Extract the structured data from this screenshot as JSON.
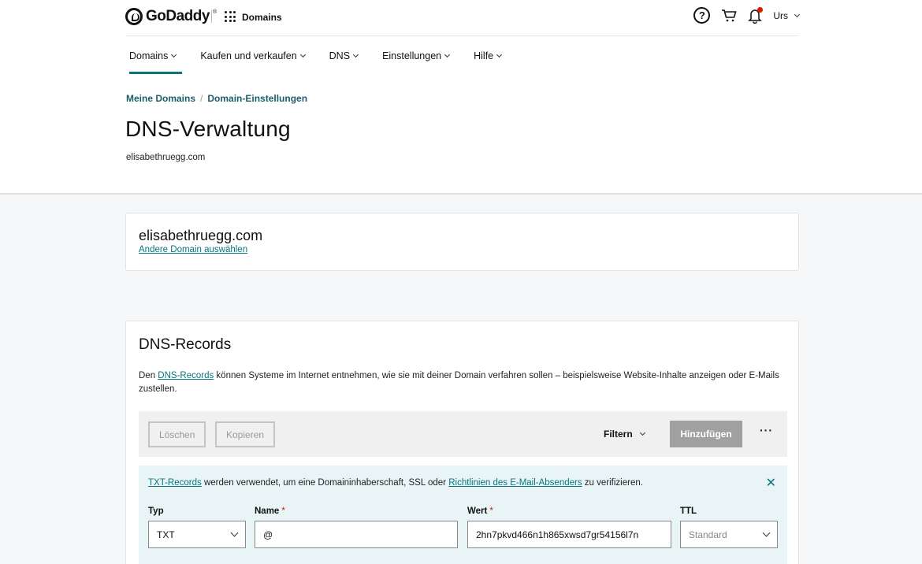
{
  "header": {
    "brand": "GoDaddy",
    "trademark": "®",
    "product": "Domains",
    "help_glyph": "?",
    "user": "Urs",
    "icons": [
      "godaddy-logo-icon",
      "apps-grid-icon",
      "help-icon",
      "cart-icon",
      "bell-icon",
      "chevron-down-icon"
    ]
  },
  "nav": {
    "items": [
      {
        "label": "Domains",
        "active": true
      },
      {
        "label": "Kaufen und verkaufen",
        "active": false
      },
      {
        "label": "DNS",
        "active": false
      },
      {
        "label": "Einstellungen",
        "active": false
      },
      {
        "label": "Hilfe",
        "active": false
      }
    ]
  },
  "breadcrumb": {
    "items": [
      "Meine Domains",
      "Domain-Einstellungen"
    ],
    "separator": "/"
  },
  "page": {
    "title": "DNS-Verwaltung",
    "subtitle": "elisabethruegg.com"
  },
  "domain_card": {
    "domain": "elisabethruegg.com",
    "link": "Andere Domain auswählen"
  },
  "dns_records": {
    "title": "DNS-Records",
    "desc_pre": "Den ",
    "desc_link": "DNS-Records",
    "desc_post": " können Systeme im Internet entnehmen, wie sie mit deiner Domain verfahren sollen – beispielsweise Website-Inhalte anzeigen oder E-Mails zustellen.",
    "toolbar": {
      "delete": "Löschen",
      "copy": "Kopieren",
      "filter": "Filtern",
      "add": "Hinzufügen",
      "more": "···"
    },
    "info": {
      "link1": "TXT-Records",
      "text1": " werden verwendet, um eine Domaininhaberschaft, SSL oder ",
      "link2": "Richtlinien des E-Mail-Absenders",
      "text2": " zu verifizieren.",
      "close": "✕"
    },
    "form": {
      "type_label": "Typ",
      "type_value": "TXT",
      "name_label": "Name",
      "name_value": "@",
      "value_label": "Wert",
      "value_value": "2hn7pkvd466n1h865xwsd7gr54156l7n",
      "ttl_label": "TTL",
      "ttl_value": "Standard",
      "required_marker": "*"
    }
  },
  "colors": {
    "accent": "#09757a",
    "breadcrumb": "#1b5e6a",
    "required": "#db1802",
    "add_button": "#a0a0a0",
    "info_bg": "#e8f4f6"
  }
}
